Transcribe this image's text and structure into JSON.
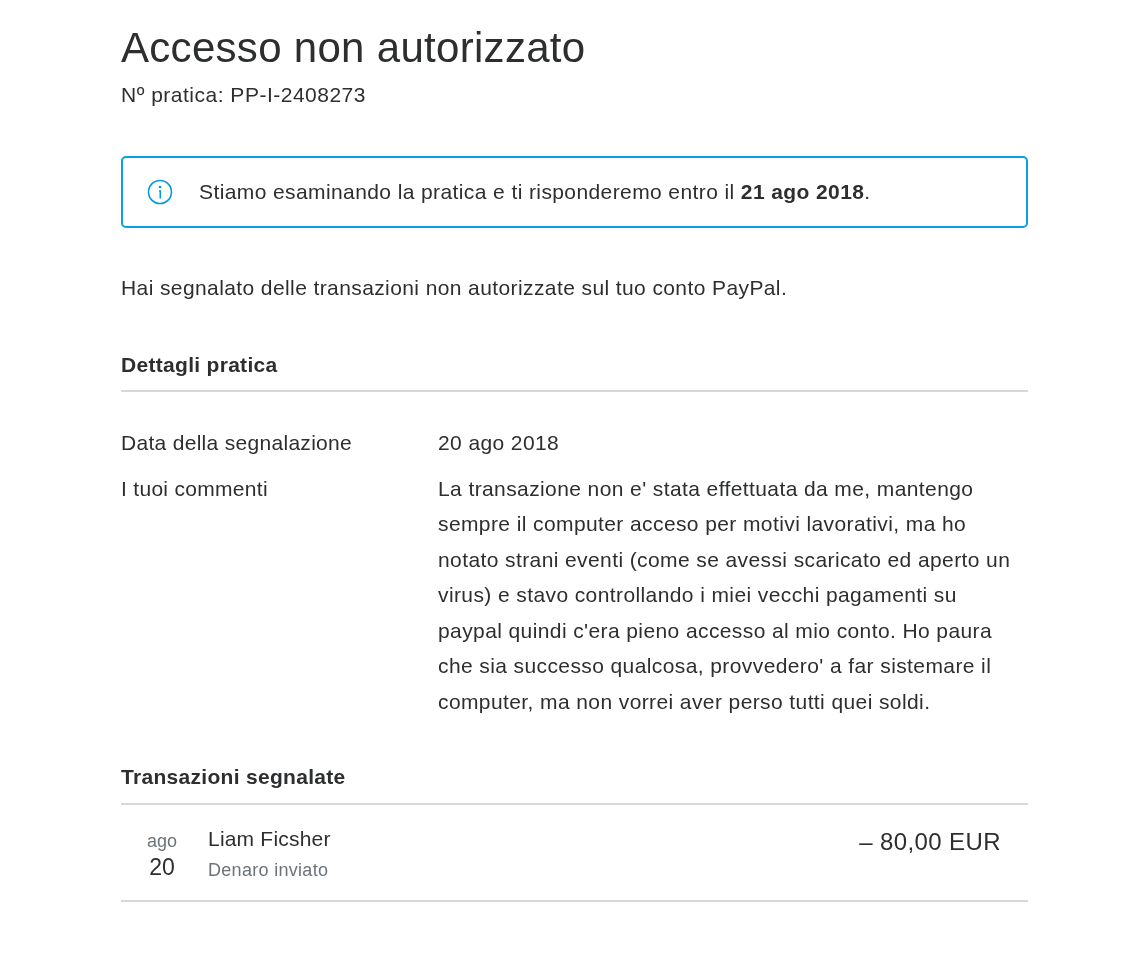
{
  "header": {
    "title": "Accesso non autorizzato",
    "case_number": "Nº pratica: PP-I-2408273"
  },
  "notice": {
    "text": "Stiamo esaminando la pratica e ti risponderemo entro il **21 ago 2018**."
  },
  "intro": "Hai segnalato delle transazioni non autorizzate sul tuo conto PayPal.",
  "details": {
    "heading": "Dettagli pratica",
    "rows": [
      {
        "label": "Data della segnalazione",
        "value": "20 ago 2018"
      },
      {
        "label": "I tuoi commenti",
        "value": "La transazione non e' stata effettuata da me, mantengo sempre il computer acceso per motivi lavorativi, ma ho notato strani eventi (come se avessi scaricato ed aperto un virus) e stavo controllando i miei vecchi pagamenti su paypal quindi c'era pieno accesso al mio conto. Ho paura che sia successo qualcosa, provvedero' a far sistemare il computer, ma non vorrei aver perso tutti quei soldi."
      }
    ]
  },
  "transactions": {
    "heading": "Transazioni segnalate",
    "items": [
      {
        "month": "ago",
        "day": "20",
        "name": "Liam Ficsher",
        "type": "Denaro inviato",
        "amount": "– 80,00 EUR"
      }
    ]
  }
}
